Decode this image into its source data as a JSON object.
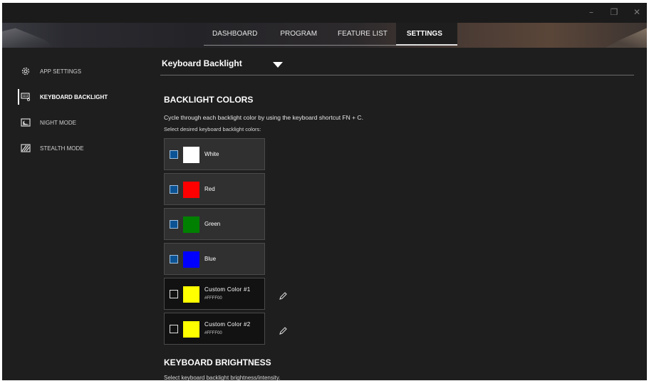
{
  "window": {
    "controls": {
      "minimize": "–",
      "restore": "❐",
      "close": "✕"
    }
  },
  "nav": {
    "tabs": [
      {
        "label": "DASHBOARD"
      },
      {
        "label": "PROGRAM"
      },
      {
        "label": "FEATURE LIST"
      },
      {
        "label": "SETTINGS"
      }
    ],
    "active_tab": "SETTINGS"
  },
  "sidebar": {
    "items": [
      {
        "label": "APP SETTINGS",
        "icon": "gear-icon"
      },
      {
        "label": "KEYBOARD BACKLIGHT",
        "icon": "keyboard-backlight-icon"
      },
      {
        "label": "NIGHT MODE",
        "icon": "night-mode-icon"
      },
      {
        "label": "STEALTH MODE",
        "icon": "stealth-mode-icon"
      }
    ],
    "active_item": "KEYBOARD BACKLIGHT"
  },
  "main": {
    "dropdown_label": "Keyboard Backlight",
    "backlight": {
      "title": "BACKLIGHT COLORS",
      "description": "Cycle through each backlight color by using the keyboard shortcut FN + C.",
      "subdescription": "Select desired keyboard backlight colors:",
      "colors": [
        {
          "name": "White",
          "hex": "#FFFFFF",
          "checked": true
        },
        {
          "name": "Red",
          "hex": "#FF0000",
          "checked": true
        },
        {
          "name": "Green",
          "hex": "#008000",
          "checked": true
        },
        {
          "name": "Blue",
          "hex": "#0000FF",
          "checked": true
        },
        {
          "name": "Custom Color #1",
          "hex": "#FFFF00",
          "hex_label": "#FFFF00",
          "checked": false
        },
        {
          "name": "Custom Color #2",
          "hex": "#FFFF00",
          "hex_label": "#FFFF00",
          "checked": false
        }
      ]
    },
    "brightness": {
      "title": "KEYBOARD BRIGHTNESS",
      "description": "Select keyboard backlight brightness/intensity."
    }
  },
  "colors": {
    "background": "#1E1E1E",
    "checkbox_checked": "#0B5394",
    "active_tab_underline": "#E0E0E0"
  }
}
